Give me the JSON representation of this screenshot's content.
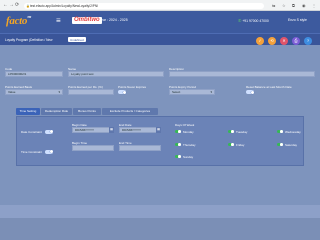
{
  "browser": {
    "url": "test.efacto.app/Admin/Loyalty/NewLoyalty/2/PNI",
    "back": "←",
    "forward": "→",
    "reload": "⟳"
  },
  "appbar": {
    "logo_text": "facto",
    "logo_mark": "TM",
    "brand": "Ombitwo",
    "year": "Year : 2024 - 2025",
    "phone": "+91 97000 47000",
    "user": "Enzo S style"
  },
  "breadcrumb": {
    "path": "Loyalty Program (Definition / New",
    "tag": "Undefined",
    "actions": [
      {
        "icon": "save-icon",
        "glyph": "✓",
        "color": "#f4a13a"
      },
      {
        "icon": "clear-icon",
        "glyph": "⟲",
        "color": "#f4a13a"
      },
      {
        "icon": "cancel-icon",
        "glyph": "✕",
        "color": "#e0546a"
      },
      {
        "icon": "print-icon",
        "glyph": "⎙",
        "color": "#7c5dd6"
      },
      {
        "icon": "help-icon",
        "glyph": "?",
        "color": "#3e8de0"
      }
    ]
  },
  "form": {
    "code_label": "Code",
    "code_value": "LPD000002/1",
    "name_label": "Name",
    "name_value": "Loyalty point test",
    "description_label": "Description",
    "description_value": "",
    "points_earned_basis_label": "Points Earned Basis",
    "points_earned_basis_value": "Value",
    "points_earned_per_label": "Points Earned per Rs. (%)",
    "points_earned_per_value": "",
    "points_never_expires_label": "Points Never Expires",
    "points_expiry_period_label": "Points Expiry Period",
    "points_expiry_period_value": "Select",
    "reset_balance_label": "Reset Balance at Last Month Date"
  },
  "tabs": [
    "Time Setting",
    "Redemption Rule",
    "Bonus Points",
    "Exclude Products / Categories"
  ],
  "time_setting": {
    "date_constraint_label": "Date Constraint",
    "time_constraint_label": "Time Constraint",
    "begin_date_label": "Begin Date",
    "begin_date_placeholder": "DD/MM/YYYY",
    "end_date_label": "End Date",
    "end_date_placeholder": "DD/MM/YYYY",
    "begin_time_label": "Begin Time",
    "end_time_label": "End Time",
    "days_label": "Days Of Week",
    "days": [
      "Monday",
      "Tuesday",
      "Wednesday",
      "Thursday",
      "Friday",
      "Saturday",
      "Sunday"
    ]
  }
}
